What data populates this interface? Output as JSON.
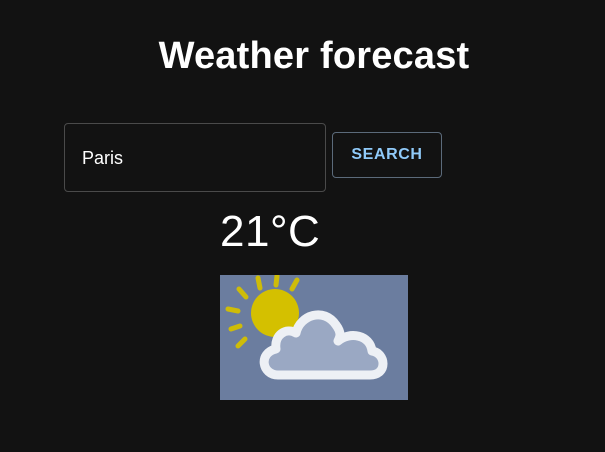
{
  "header": {
    "title": "Weather forecast"
  },
  "search": {
    "city_value": "Paris",
    "button_label": "SEARCH"
  },
  "result": {
    "temperature": "21°C",
    "condition_icon": "partly-cloudy-icon"
  },
  "colors": {
    "background": "#121212",
    "accent": "#90caf9",
    "sun": "#d4c000",
    "cloud_outline": "#e9ecf2",
    "icon_background": "#6b7d9f"
  }
}
